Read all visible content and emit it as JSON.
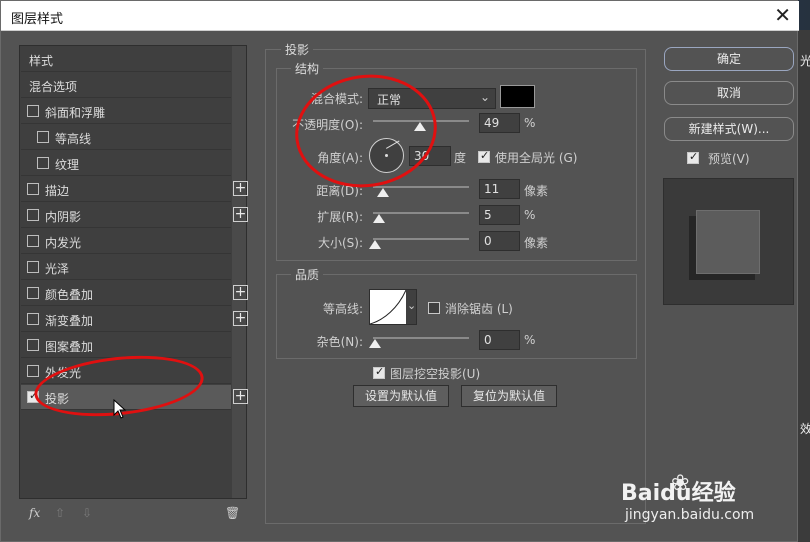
{
  "window": {
    "title": "图层样式",
    "close_glyph": "✕"
  },
  "sidebar": {
    "header": "样式",
    "blend_options": "混合选项",
    "items": [
      {
        "label": "斜面和浮雕",
        "checked": false,
        "plus": false
      },
      {
        "label": "等高线",
        "checked": false,
        "plus": false
      },
      {
        "label": "纹理",
        "checked": false,
        "plus": false
      },
      {
        "label": "描边",
        "checked": false,
        "plus": true
      },
      {
        "label": "内阴影",
        "checked": false,
        "plus": true
      },
      {
        "label": "内发光",
        "checked": false,
        "plus": false
      },
      {
        "label": "光泽",
        "checked": false,
        "plus": false
      },
      {
        "label": "颜色叠加",
        "checked": false,
        "plus": true
      },
      {
        "label": "渐变叠加",
        "checked": false,
        "plus": true
      },
      {
        "label": "图案叠加",
        "checked": false,
        "plus": false
      },
      {
        "label": "外发光",
        "checked": false,
        "plus": false
      },
      {
        "label": "投影",
        "checked": true,
        "plus": true,
        "selected": true
      }
    ],
    "footer": {
      "fx": "fx",
      "up": "⇧",
      "down": "⇩",
      "trash": "🗑"
    }
  },
  "shadow": {
    "title": "投影",
    "structure": {
      "title": "结构",
      "blend_mode_label": "混合模式:",
      "blend_mode_value": "正常",
      "opacity_label": "不透明度(O):",
      "opacity_value": "49",
      "opacity_unit": "%",
      "angle_label": "角度(A):",
      "angle_value": "30",
      "angle_unit": "度",
      "global_light_label": "使用全局光 (G)",
      "distance_label": "距离(D):",
      "distance_value": "11",
      "distance_unit": "像素",
      "spread_label": "扩展(R):",
      "spread_value": "5",
      "spread_unit": "%",
      "size_label": "大小(S):",
      "size_value": "0",
      "size_unit": "像素"
    },
    "quality": {
      "title": "品质",
      "contour_label": "等高线:",
      "antialias_label": "消除锯齿 (L)",
      "noise_label": "杂色(N):",
      "noise_value": "0",
      "noise_unit": "%"
    },
    "knockout_label": "图层挖空投影(U)",
    "set_default": "设置为默认值",
    "reset_default": "复位为默认值"
  },
  "right": {
    "ok": "确定",
    "cancel": "取消",
    "new_style": "新建样式(W)...",
    "preview_label": "预览(V)"
  },
  "background_right": {
    "glyph1": "光",
    "glyph2": "效"
  },
  "watermark": {
    "brand": "Baidu经验",
    "url": "jingyan.baidu.com"
  },
  "colors": {
    "shadow_color": "#000000",
    "annotation": "#e01010"
  }
}
